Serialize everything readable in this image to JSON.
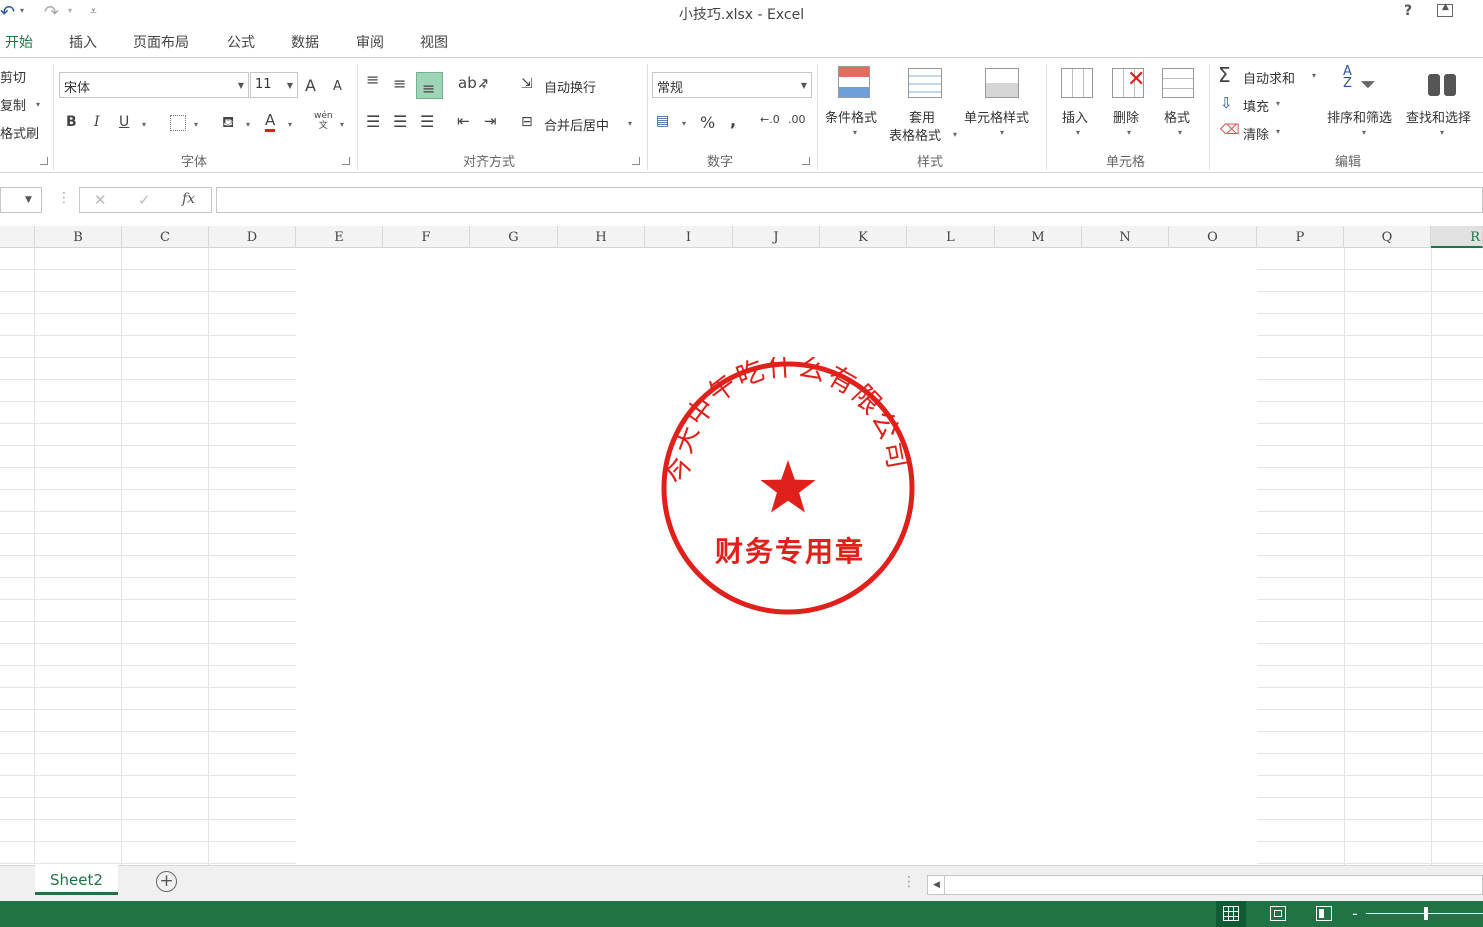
{
  "window": {
    "title": "小技巧.xlsx - Excel",
    "help": "?"
  },
  "qat": {
    "undo": "↶",
    "redo": "↷",
    "customize": "⩡"
  },
  "tabs": [
    "开始",
    "插入",
    "页面布局",
    "公式",
    "数据",
    "审阅",
    "视图"
  ],
  "clipboard": {
    "cut": "剪切",
    "copy": "复制",
    "format_painter": "格式刷"
  },
  "font": {
    "name": "宋体",
    "size": "11",
    "bold": "B",
    "italic": "I",
    "underline": "U",
    "grow": "A",
    "shrink": "A",
    "color_letter": "A",
    "phonetic": "wén"
  },
  "alignment": {
    "wrap_text": "自动换行",
    "merge_center": "合并后居中"
  },
  "number": {
    "format": "常规",
    "percent": "%",
    "comma": ","
  },
  "styles": {
    "conditional": "条件格式",
    "table_line1": "套用",
    "table_line2": "表格格式",
    "cell_styles": "单元格样式"
  },
  "cells": {
    "insert": "插入",
    "delete": "删除",
    "format": "格式"
  },
  "editing": {
    "autosum": "自动求和",
    "fill": "填充",
    "clear": "清除",
    "sort_filter": "排序和筛选",
    "find_select": "查找和选择"
  },
  "group_labels": {
    "font": "字体",
    "alignment": "对齐方式",
    "number": "数字",
    "styles": "样式",
    "cells": "单元格",
    "editing": "编辑"
  },
  "formula_bar": {
    "cancel": "✕",
    "confirm": "✓",
    "fx": "fx"
  },
  "columns": [
    "B",
    "C",
    "D",
    "E",
    "F",
    "G",
    "H",
    "I",
    "J",
    "K",
    "L",
    "M",
    "N",
    "O",
    "P",
    "Q",
    "R"
  ],
  "stamp": {
    "company": "今天中午吃什么有限公司",
    "purpose": "财务专用章",
    "color": "#e0201b"
  },
  "sheets": [
    {
      "name": "Sheet2",
      "active": true
    }
  ],
  "colors": {
    "accent": "#217346",
    "gridline": "#e4e4e4"
  }
}
